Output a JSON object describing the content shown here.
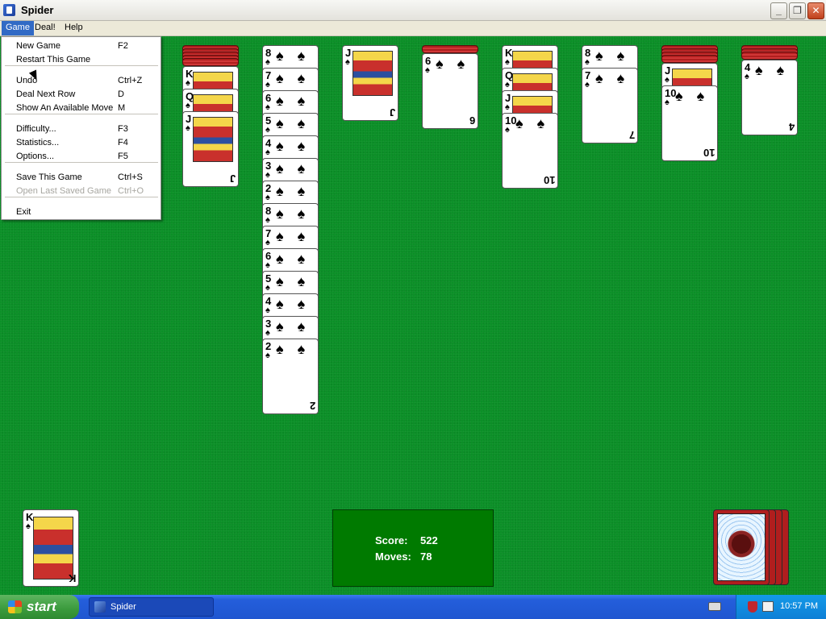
{
  "window": {
    "title": "Spider"
  },
  "menubar": {
    "items": [
      "Game",
      "Deal!",
      "Help"
    ]
  },
  "game_menu": {
    "items": [
      {
        "label": "New Game",
        "shortcut": "F2",
        "enabled": true
      },
      {
        "label": "Restart This Game",
        "shortcut": "",
        "enabled": true
      },
      {
        "label": "Undo",
        "shortcut": "Ctrl+Z",
        "enabled": true
      },
      {
        "label": "Deal Next Row",
        "shortcut": "D",
        "enabled": true
      },
      {
        "label": "Show An Available Move",
        "shortcut": "M",
        "enabled": true
      },
      {
        "label": "Difficulty...",
        "shortcut": "F3",
        "enabled": true
      },
      {
        "label": "Statistics...",
        "shortcut": "F4",
        "enabled": true
      },
      {
        "label": "Options...",
        "shortcut": "F5",
        "enabled": true
      },
      {
        "label": "Save This Game",
        "shortcut": "Ctrl+S",
        "enabled": true
      },
      {
        "label": "Open Last Saved Game",
        "shortcut": "Ctrl+O",
        "enabled": false
      },
      {
        "label": "Exit",
        "shortcut": "",
        "enabled": true
      }
    ]
  },
  "tableau": [
    {
      "hidden": 5,
      "cards": [
        "K",
        "Q",
        "J"
      ]
    },
    {
      "hidden": 0,
      "cards": [
        "8",
        "7",
        "6",
        "5",
        "4",
        "3",
        "2",
        "8",
        "7",
        "6",
        "5",
        "4",
        "3",
        "2"
      ]
    },
    {
      "hidden": 0,
      "cards": [
        "J"
      ]
    },
    {
      "hidden": 1,
      "cards": [
        "6"
      ]
    },
    {
      "hidden": 0,
      "cards": [
        "K",
        "Q",
        "J",
        "10"
      ]
    },
    {
      "hidden": 0,
      "cards": [
        "8",
        "7"
      ]
    },
    {
      "hidden": 4,
      "cards": [
        "J",
        "10"
      ]
    },
    {
      "hidden": 3,
      "cards": [
        "4"
      ]
    }
  ],
  "suit": "♠",
  "completed_pile": {
    "top_card": "K"
  },
  "score": {
    "score_label": "Score:",
    "score_value": "522",
    "moves_label": "Moves:",
    "moves_value": "78"
  },
  "stock": {
    "remaining_deals": 4
  },
  "taskbar": {
    "start_label": "start",
    "task_label": "Spider",
    "clock": "10:57 PM"
  },
  "colors": {
    "felt": "#0b8f27",
    "card_back": "#b01e1e",
    "menu_highlight": "#316ac5",
    "score_box": "#007a00"
  }
}
